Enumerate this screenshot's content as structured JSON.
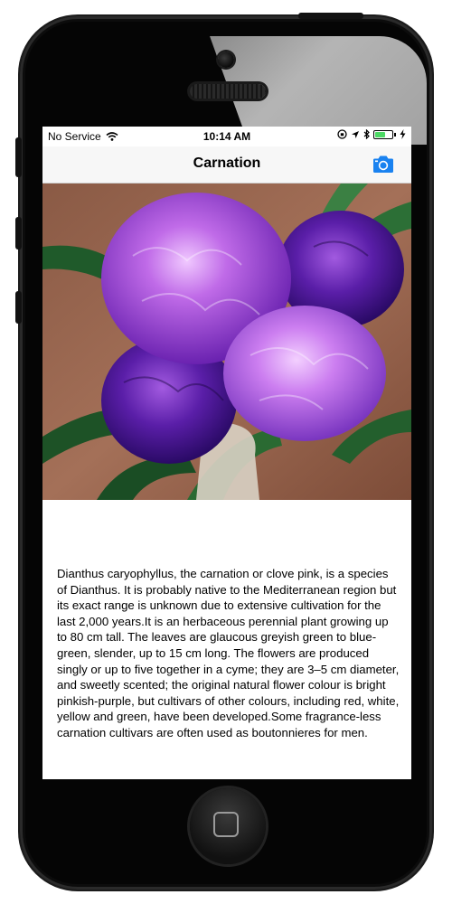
{
  "status_bar": {
    "carrier": "No Service",
    "time": "10:14 AM",
    "battery_level": 0.6
  },
  "nav_bar": {
    "title": "Carnation",
    "camera_icon": "camera-icon"
  },
  "colors": {
    "accent": "#1a82f0",
    "battery": "#4cd964"
  },
  "description": "Dianthus caryophyllus, the carnation or clove pink, is a species of Dianthus. It is probably native to the Mediterranean region but its exact range is unknown due to extensive cultivation for the last 2,000 years.It is an herbaceous perennial plant growing up to 80 cm tall. The leaves are glaucous greyish green to blue-green, slender, up to 15 cm long. The flowers are produced singly or up to five together in a cyme; they are 3–5 cm diameter, and sweetly scented; the original natural flower colour is bright pinkish-purple, but cultivars of other colours, including red, white, yellow and green, have been developed.Some fragrance-less carnation cultivars are often used as boutonnieres for men."
}
